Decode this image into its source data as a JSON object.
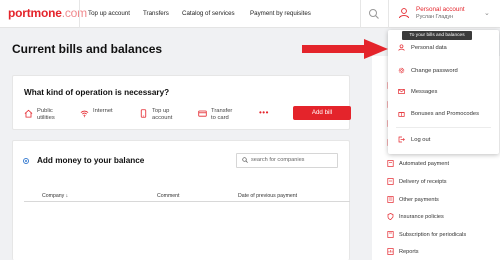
{
  "brand": {
    "name": "portmone",
    "domain": ".com",
    "color": "#e4242b"
  },
  "nav": {
    "items": [
      "Top up account",
      "Transfers",
      "Catalog of services",
      "Payment by requisites"
    ]
  },
  "account": {
    "title": "Personal account",
    "name": "Руслан Гладун",
    "tooltip": "To your bills and balances"
  },
  "page": {
    "title": "Current bills and balances"
  },
  "operation": {
    "title": "What kind of operation is necessary?",
    "items": [
      {
        "label_1": "Public",
        "label_2": "utilities",
        "icon": "house-icon"
      },
      {
        "label_1": "Internet",
        "label_2": "",
        "icon": "wifi-icon"
      },
      {
        "label_1": "Top up",
        "label_2": "account",
        "icon": "phone-icon"
      },
      {
        "label_1": "Transfer",
        "label_2": "to card",
        "icon": "card-icon"
      }
    ],
    "more": "•••",
    "add_button": "Add bill"
  },
  "balance": {
    "title": "Add money to your balance",
    "search_placeholder": "search for companies",
    "columns": [
      "Company ↓",
      "Comment",
      "Date of previous payment"
    ]
  },
  "dropdown": {
    "items": [
      "Personal data",
      "Change password",
      "Messages",
      "Bonuses and Promocodes",
      "Log out"
    ]
  },
  "sidebar": {
    "items": [
      "Automated payment",
      "Delivery of receipts",
      "Other payments",
      "Insurance policies",
      "Subscription for periodicals",
      "Reports"
    ]
  },
  "colors": {
    "accent": "#e4242b",
    "blue": "#3d7fd1",
    "tooltip_bg": "#3b3b3b"
  }
}
